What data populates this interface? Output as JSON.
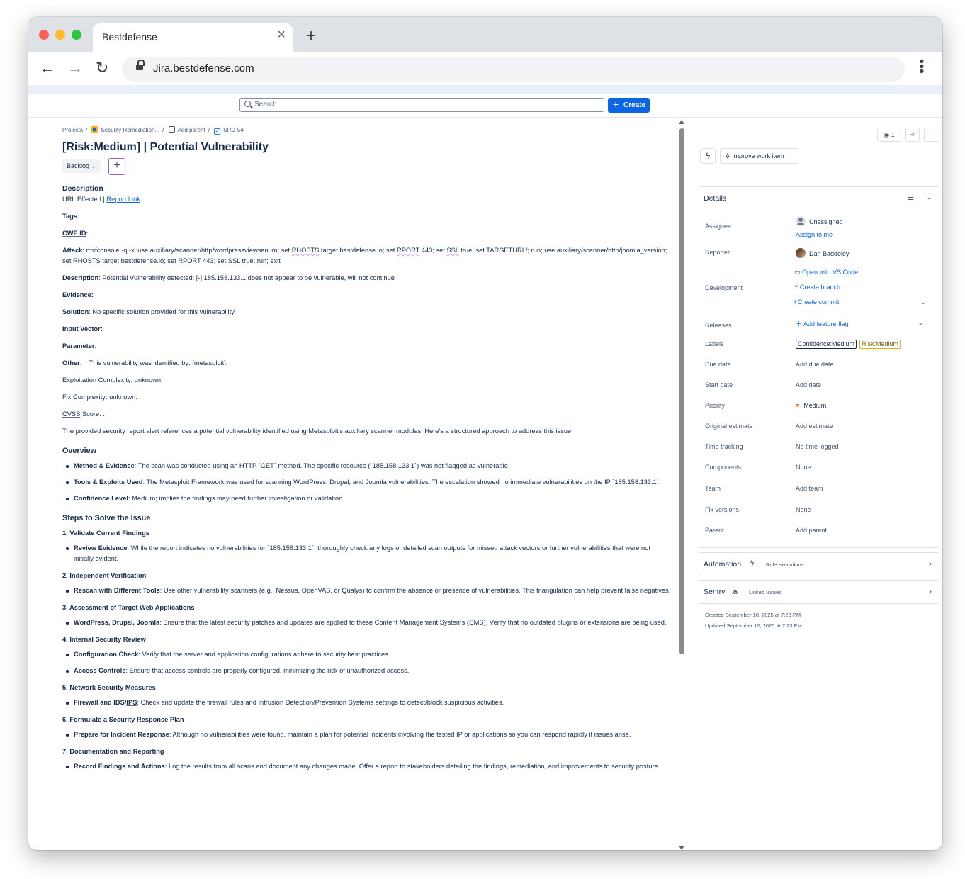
{
  "browser": {
    "tab_title": "Bestdefense",
    "url": "Jira.bestdefense.com"
  },
  "topnav": {
    "search_placeholder": "Search",
    "create_label": "Create"
  },
  "breadcrumbs": {
    "projects": "Projects",
    "project": "Security Remediation...",
    "add_parent": "Add parent",
    "issue_key": "SRD-54"
  },
  "issue": {
    "title": "[Risk:Medium] | Potential Vulnerability",
    "status": "Backlog"
  },
  "description": {
    "heading": "Description",
    "url_effected": "URL Effected",
    "report_link": "Report Link",
    "tags_label": "Tags",
    "cwe_label": "CWE ID",
    "attack_label": "Attack",
    "attack_p1": ": msfconsole -q -x 'use auxiliary/scanner/http/wordpressviewsenum; set ",
    "rhosts": "RHOSTS",
    "attack_p2": " target.bestdefense.io; set ",
    "rport": "RPORT",
    "attack_p3": " 443; set ",
    "ssl": "SSL",
    "attack_p4": " true; set TARGETURI /; run; use auxiliary/scanner/http/joomla_version; set RHOSTS target.bestdefense.io; set RPORT 443; set SSL true; run; exit'",
    "desc_label": "Description",
    "desc_text": ": Potential Vulnerability detected: [-] 185.158.133.1 does not appear to be vulnerable, will not continue",
    "evidence_label": "Evidence",
    "solution_label": "Solution",
    "solution_text": ": No specific solution provided for this vulnerability.",
    "input_vector_label": "Input Vector",
    "parameter_label": "Parameter",
    "other_label": "Other",
    "other_text": "This vulnerability was identified by: [metasploit].",
    "exploitation": "Exploitation Complexity: unknown.",
    "fix_complexity": "Fix Complexity: unknown.",
    "cvss": "CVSS",
    "cvss_rest": " Score: .",
    "intro": "The provided security report alert references a potential vulnerability identified using Metasploit's auxiliary scanner modules. Here's a structured approach to address this issue:"
  },
  "overview": {
    "heading": "Overview",
    "items": [
      {
        "bold": "Method & Evidence",
        "text": ": The scan was conducted using an HTTP `GET` method. The specific resource (`185.158.133.1`) was not flagged as vulnerable."
      },
      {
        "bold": "Tools & Exploits Used",
        "text": ": The Metasploit Framework was used for scanning WordPress, Drupal, and Joomla vulnerabilities. The escalation showed no immediate vulnerabilities on the IP `185.158.133.1`."
      },
      {
        "bold": "Confidence Level",
        "text": ": Medium; implies the findings may need further investigation or validation."
      }
    ]
  },
  "steps": {
    "heading": "Steps to Solve the Issue",
    "s1": {
      "title": "1. Validate Current Findings",
      "items": [
        {
          "bold": "Review Evidence",
          "text": ": While the report indicates no vulnerabilities for `185.158.133.1`, thoroughly check any logs or detailed scan outputs for missed attack vectors or further vulnerabilities that were not initially evident."
        }
      ]
    },
    "s2": {
      "title": "2. Independent Verification",
      "items": [
        {
          "bold": "Rescan with Different Tools",
          "text": ": Use other vulnerability scanners (e.g., Nessus, OpenVAS, or Qualys) to confirm the absence or presence of vulnerabilities. This triangulation can help prevent false negatives."
        }
      ]
    },
    "s3": {
      "title": "3. Assessment of Target Web Applications",
      "items": [
        {
          "bold": "WordPress, Drupal, Joomla",
          "text": ": Ensure that the latest security patches and updates are applied to these Content Management Systems (CMS). Verify that no outdated plugins or extensions are being used."
        }
      ]
    },
    "s4": {
      "title": "4. Internal Security Review",
      "items": [
        {
          "bold": "Configuration Check",
          "text": ": Verify that the server and application configurations adhere to security best practices."
        },
        {
          "bold": "Access Controls",
          "text": ": Ensure that access controls are properly configured, minimizing the risk of unauthorized access."
        }
      ]
    },
    "s5": {
      "title": "5. Network Security Measures",
      "items": [
        {
          "bold_a": "Firewall and IDS/",
          "bold_b": "IPS",
          "text": ": Check and update the firewall rules and Intrusion Detection/Prevention Systems settings to detect/block suspicious activities."
        }
      ]
    },
    "s6": {
      "title": "6. Formulate a Security Response Plan",
      "items": [
        {
          "bold": "Prepare for Incident Response",
          "text": ": Although no vulnerabilities were found, maintain a plan for potential incidents involving the tested IP or applications so you can respond rapidly if issues arise."
        }
      ]
    },
    "s7": {
      "title": "7. Documentation and Reporting",
      "items": [
        {
          "bold": "Record Findings and Actions",
          "text": ": Log the results from all scans and document any changes made. Offer a report to stakeholders detailing the findings, remediation, and improvements to security posture."
        }
      ]
    }
  },
  "sidebar": {
    "watchers": "1",
    "improve_label": "Improve work item",
    "details_heading": "Details",
    "fields": {
      "assignee": {
        "label": "Assignee",
        "value": "Unassigned",
        "action": "Assign to me"
      },
      "reporter": {
        "label": "Reporter",
        "value": "Dan Baddeley"
      },
      "development": {
        "label": "Development",
        "vscode": "Open with VS Code",
        "branch": "Create branch",
        "commit": "Create commit"
      },
      "releases": {
        "label": "Releases",
        "value": "Add feature flag"
      },
      "labels": {
        "label": "Labels",
        "items": [
          "Confidence:Medium",
          "Risk:Medium"
        ]
      },
      "due_date": {
        "label": "Due date",
        "value": "Add due date"
      },
      "start_date": {
        "label": "Start date",
        "value": "Add date"
      },
      "priority": {
        "label": "Priority",
        "value": "Medium"
      },
      "original_estimate": {
        "label": "Original estimate",
        "value": "Add estimate"
      },
      "time_tracking": {
        "label": "Time tracking",
        "value": "No time logged"
      },
      "components": {
        "label": "Components",
        "value": "None"
      },
      "team": {
        "label": "Team",
        "value": "Add team"
      },
      "fix_versions": {
        "label": "Fix versions",
        "value": "None"
      },
      "parent": {
        "label": "Parent",
        "value": "Add parent"
      }
    },
    "automation": {
      "label": "Automation",
      "sub": "Rule executions"
    },
    "sentry": {
      "label": "Sentry",
      "sub": "Linked Issues"
    },
    "created": "Created September 10, 2025 at 7:23 PM",
    "updated": "Updated September 10, 2025 at 7:23 PM"
  }
}
